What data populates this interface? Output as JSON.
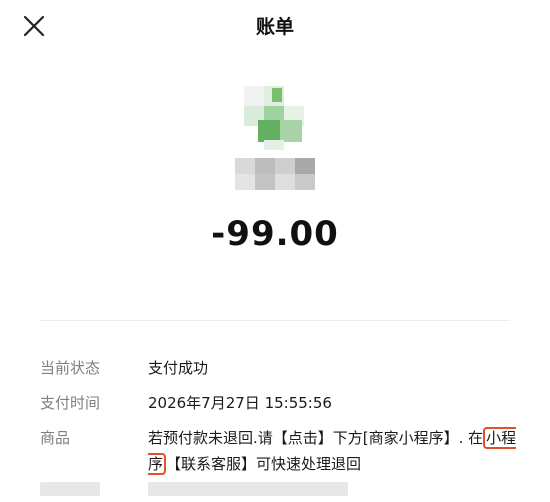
{
  "header": {
    "title": "账单",
    "close_icon": "close-icon"
  },
  "merchant": {
    "logo_colors": [
      "#f4f4f4",
      "#7ec97e",
      "#c9e3c9",
      "#5aa65a",
      "#eaf4ea",
      "#b3d9b3"
    ],
    "name_blur_color": "#c8c8c8"
  },
  "amount": "-99.00",
  "details": {
    "status_label": "当前状态",
    "status_value": "支付成功",
    "time_label": "支付时间",
    "time_value": "2026年7月27日 15:55:56",
    "goods_label": "商品",
    "goods_value_part1": "若预付款未退回.请【点击】下方[商家小程序】. 在",
    "goods_value_highlight": "小程序",
    "goods_value_part2": "【联系客服】可快速处理退回"
  },
  "colors": {
    "highlight_border": "#e0502c",
    "label_gray": "#808080"
  }
}
